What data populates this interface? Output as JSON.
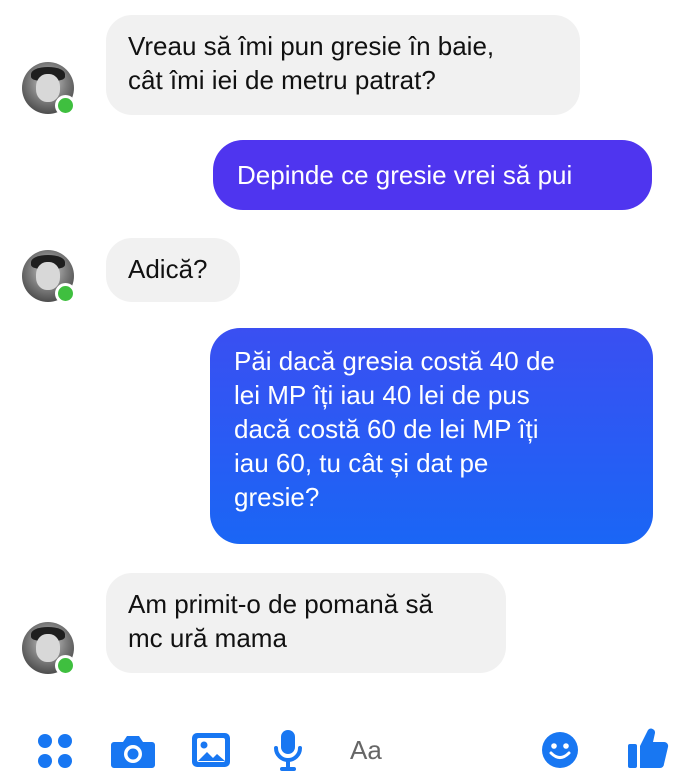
{
  "colors": {
    "incoming_bubble": "#f1f1f1",
    "outgoing_bubble_top": "#5b31f0",
    "outgoing_bubble_bottom": "#1a66f5",
    "accent": "#1877f2",
    "online": "#3fbf3f"
  },
  "messages": [
    {
      "from": "contact",
      "lines": [
        "Vreau să îmi pun gresie în baie,",
        "cât îmi iei de metru patrat?"
      ]
    },
    {
      "from": "me",
      "lines": [
        "Depinde ce gresie vrei să pui"
      ]
    },
    {
      "from": "contact",
      "lines": [
        "Adică?"
      ]
    },
    {
      "from": "me",
      "lines": [
        "Păi dacă gresia costă 40 de",
        "lei MP îți iau 40 lei de pus",
        "dacă costă 60 de lei MP îți",
        "iau 60, tu cât și dat pe",
        "gresie?"
      ]
    },
    {
      "from": "contact",
      "lines": [
        "Am primit-o de pomană să",
        "mc ură mama"
      ]
    }
  ],
  "composer": {
    "placeholder": "Aa",
    "icons": [
      "apps-icon",
      "camera-icon",
      "gallery-icon",
      "microphone-icon",
      "emoji-icon",
      "thumbs-up-icon"
    ]
  }
}
